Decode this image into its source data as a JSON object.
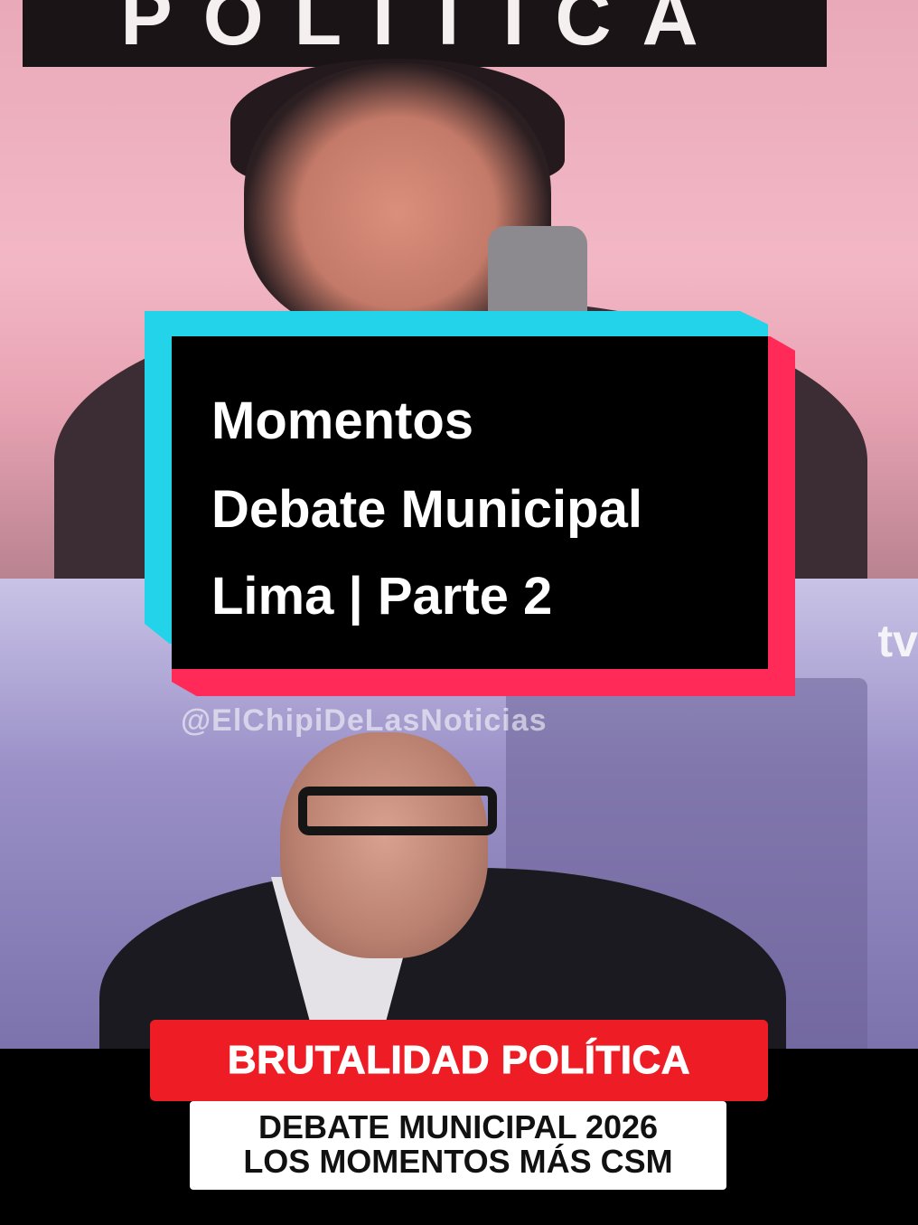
{
  "top_banner": {
    "text": "POLITICA"
  },
  "title_card": {
    "line1": "Momentos",
    "line2": "Debate Municipal",
    "line3": "Lima | Parte 2"
  },
  "watermark": "@ElChipiDeLasNoticias",
  "channel_logo": "tv",
  "caption_banner": "BRUTALIDAD POLÍTICA",
  "caption_box": {
    "line1": "DEBATE MUNICIPAL 2026",
    "line2": "LOS MOMENTOS MÁS CSM"
  },
  "colors": {
    "title_bg": "#000000",
    "accent_cyan": "#22d3ea",
    "accent_red": "#ff2a57",
    "banner_red": "#ee1c24"
  }
}
